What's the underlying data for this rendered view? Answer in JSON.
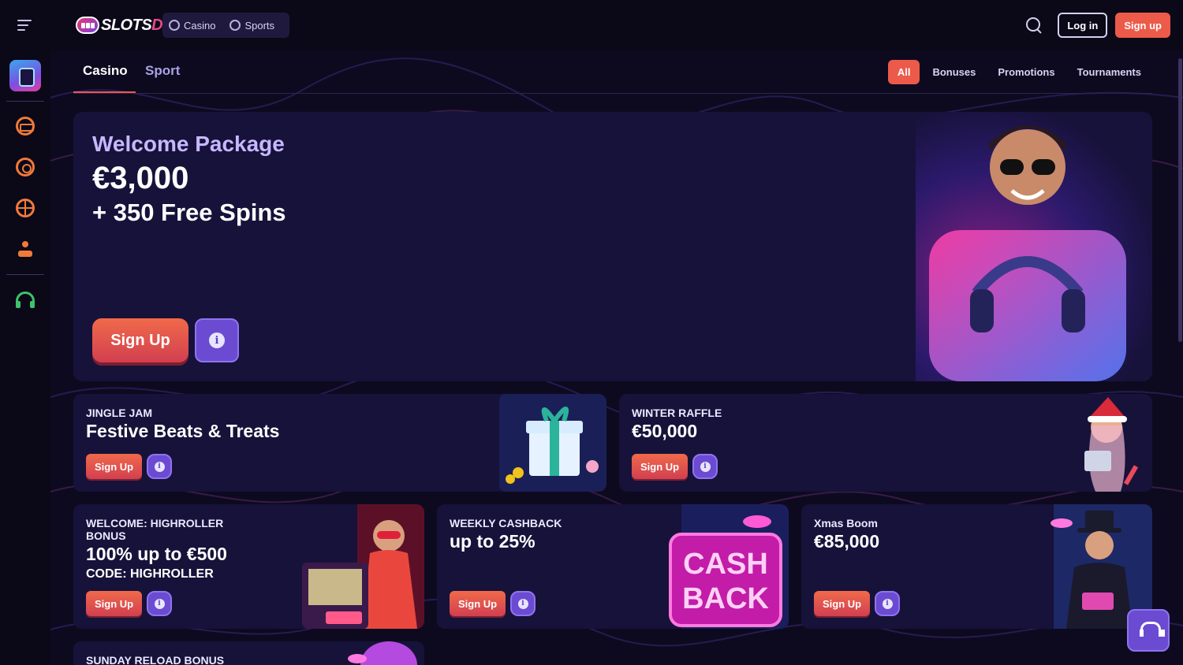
{
  "header": {
    "logo_text": "SLOTS",
    "logo_text_accent": "DJ",
    "nav": [
      {
        "label": "Casino",
        "icon": "slot-icon"
      },
      {
        "label": "Sports",
        "icon": "ball-icon"
      }
    ],
    "login_label": "Log in",
    "signup_label": "Sign up"
  },
  "sidebar": {
    "icons": [
      "dj-mascot-icon",
      "slot-machine-icon",
      "target-icon",
      "basketball-icon",
      "joystick-icon",
      "headset-icon"
    ]
  },
  "tabs": {
    "items": [
      "Casino",
      "Sport"
    ],
    "active": "Casino"
  },
  "filters": {
    "items": [
      "All",
      "Bonuses",
      "Promotions",
      "Tournaments"
    ],
    "active": "All"
  },
  "hero": {
    "tag": "Welcome Package",
    "amount": "€3,000",
    "subtitle": "+ 350 Free Spins",
    "button": "Sign Up"
  },
  "cards": [
    {
      "tag": "JINGLE JAM",
      "title": "Festive Beats & Treats",
      "button": "Sign Up"
    },
    {
      "tag": "WINTER RAFFLE",
      "title": "€50,000",
      "button": "Sign Up"
    },
    {
      "tag": "WELCOME: HIGHROLLER BONUS",
      "title": "100% up to €500",
      "subtitle": "CODE: HIGHROLLER",
      "button": "Sign Up"
    },
    {
      "tag": "WEEKLY CASHBACK",
      "title": "up to 25%",
      "button": "Sign Up"
    },
    {
      "tag": "Xmas Boom",
      "title": "€85,000",
      "button": "Sign Up"
    },
    {
      "tag": "SUNDAY RELOAD BONUS"
    }
  ],
  "cashback_art_text": [
    "CASH",
    "BACK"
  ],
  "colors": {
    "background": "#0d0a1f",
    "card": "#17123a",
    "accent": "#ec5a4a",
    "info_purple": "#6a4bd1",
    "tag_purple": "#c7b8ff"
  }
}
